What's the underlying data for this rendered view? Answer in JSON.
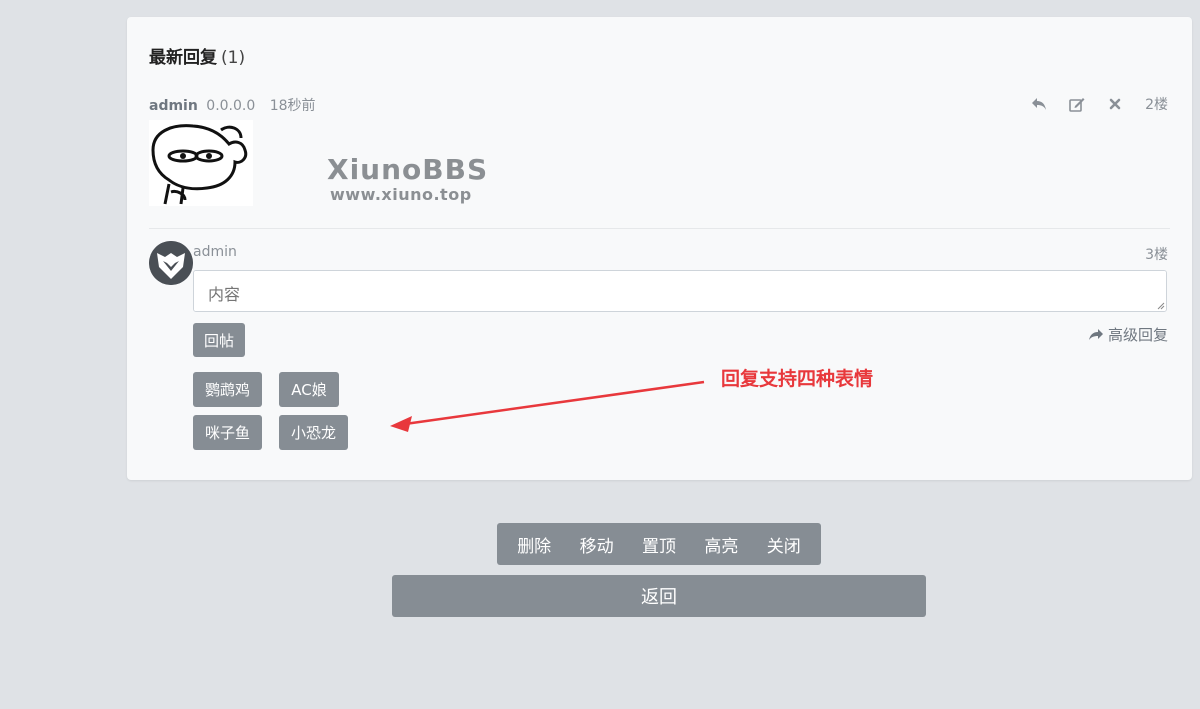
{
  "latest_replies": {
    "title": "最新回复",
    "count": "(1)"
  },
  "post": {
    "username": "admin",
    "ip": "0.0.0.0",
    "time": "18秒前",
    "floor": "2楼",
    "watermark_brand": "XiunoBBS",
    "watermark_url": "www.xiuno.top"
  },
  "reply_form": {
    "username": "admin",
    "floor": "3楼",
    "placeholder": "内容",
    "submit_label": "回帖",
    "advanced_label": "高级回复"
  },
  "emoji_sets": [
    "鹦鹉鸡",
    "AC娘",
    "咪子鱼",
    "小恐龙"
  ],
  "annotation": "回复支持四种表情",
  "toolbar": {
    "items": [
      "删除",
      "移动",
      "置顶",
      "高亮",
      "关闭"
    ]
  },
  "back_label": "返回",
  "colors": {
    "button_bg": "#868d94",
    "annotation": "#e8383c",
    "page_bg": "#dfe2e6"
  }
}
